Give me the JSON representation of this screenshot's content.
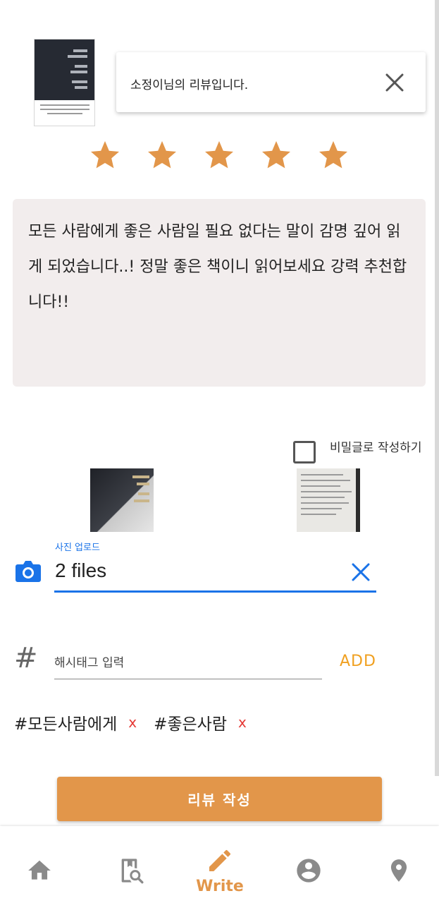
{
  "header": {
    "title": "소정이님의 리뷰입니다."
  },
  "rating": {
    "stars": 5,
    "max": 5,
    "color": "#e2964a"
  },
  "review": {
    "text": "모든 사람에게 좋은 사람일 필요 없다는 말이 감명 깊어 읽게 되었습니다..! 정말 좋은 책이니 읽어보세요 강력 추천합니다!!"
  },
  "secret": {
    "label": "비밀글로 작성하기",
    "checked": false
  },
  "upload": {
    "label": "사진 업로드",
    "value": "2 files",
    "accent": "#1a73e8"
  },
  "hashtag": {
    "placeholder": "해시태그 입력",
    "add_label": "ADD",
    "tags": [
      "#모든사람에게",
      "#좋은사람"
    ],
    "remove_label": "x"
  },
  "submit": {
    "label": "리뷰 작성"
  },
  "nav": {
    "items": [
      {
        "icon": "home-icon",
        "label": ""
      },
      {
        "icon": "book-search-icon",
        "label": ""
      },
      {
        "icon": "pencil-icon",
        "label": "Write",
        "active": true
      },
      {
        "icon": "account-circle-icon",
        "label": ""
      },
      {
        "icon": "map-marker-icon",
        "label": ""
      }
    ],
    "active_color": "#e2964a",
    "inactive_color": "#8a8a8a"
  }
}
